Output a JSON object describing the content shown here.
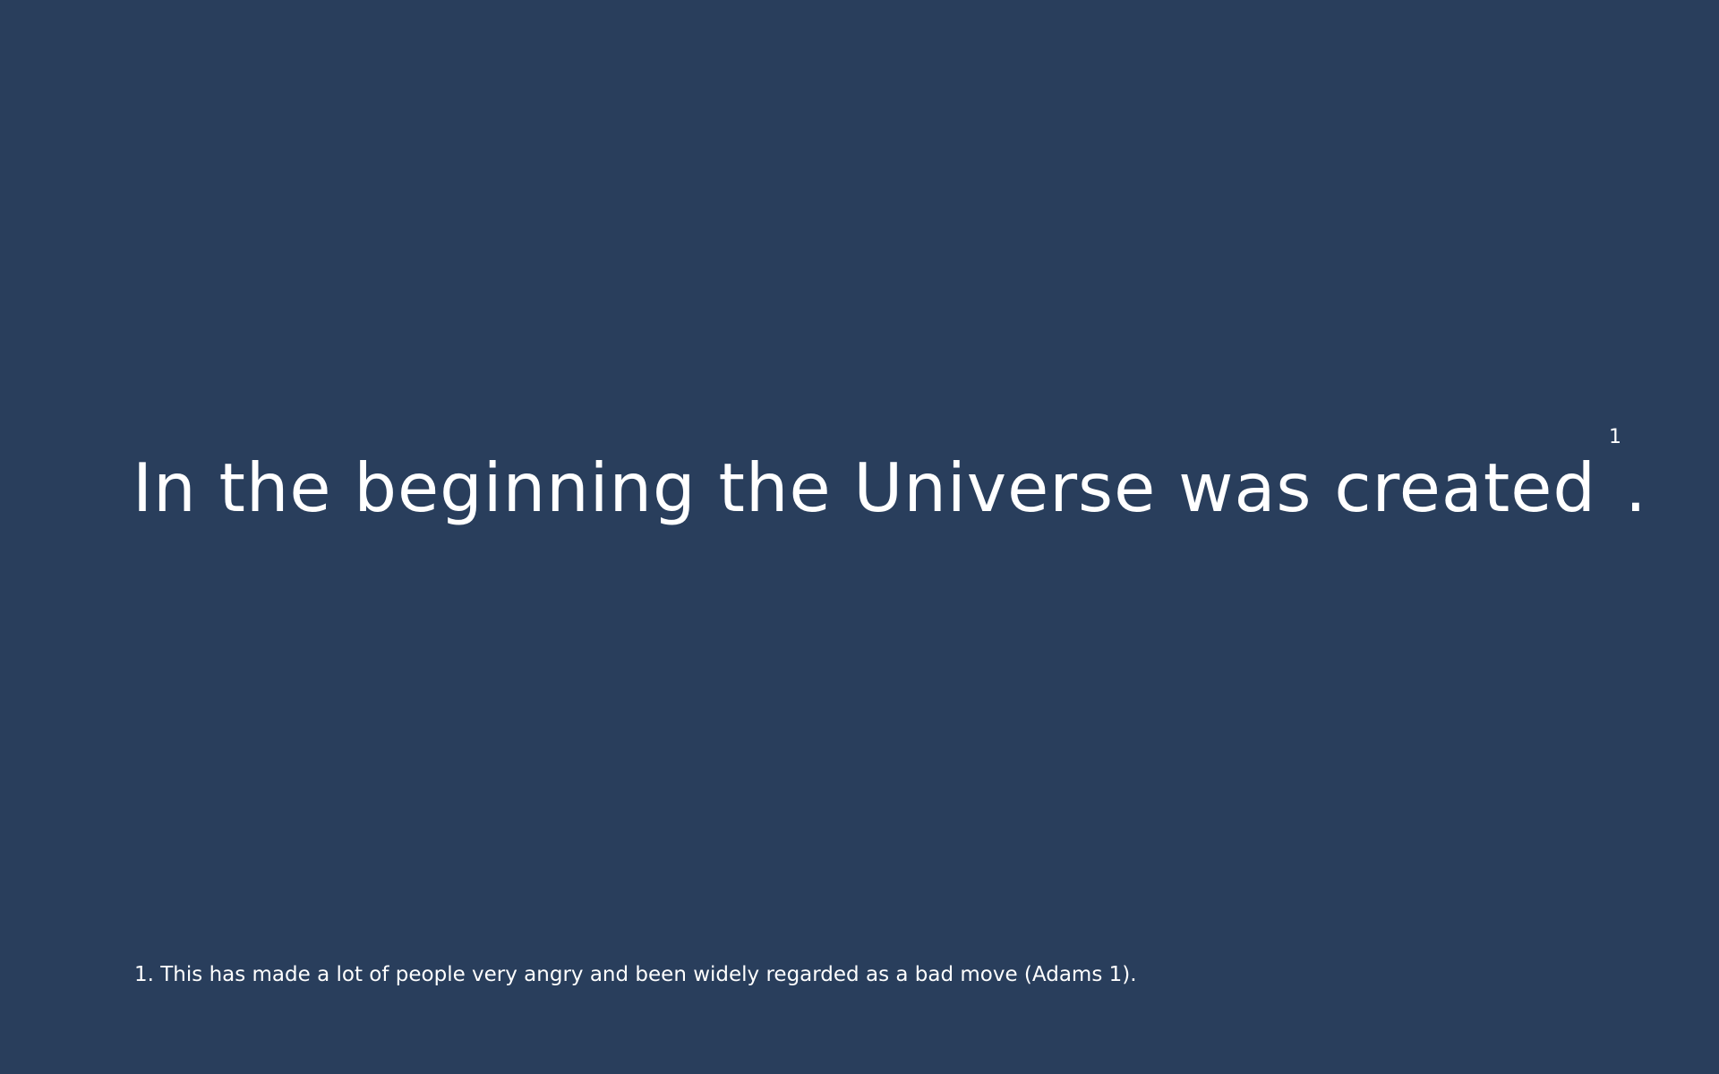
{
  "slide": {
    "background": "#293e5c",
    "text_color": "#ffffff",
    "main_text": "In the beginning the Universe was created",
    "footnote_marker": "1",
    "main_text_end": ".",
    "footnote_text": "1. This has made a lot of people very angry and been widely regarded as a bad move (Adams 1)."
  }
}
